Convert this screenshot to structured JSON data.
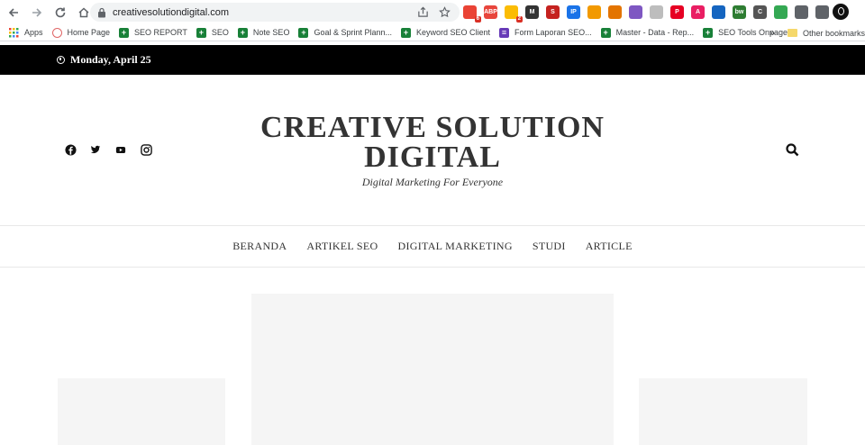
{
  "browser": {
    "url": "creativesolutiondigital.com",
    "extensions": [
      {
        "name": "gmail-extension-icon",
        "color": "#ea4335",
        "badge": "6"
      },
      {
        "name": "adblock-icon",
        "color": "#e8453c",
        "label": "ABP"
      },
      {
        "name": "extension-2-icon",
        "color": "#fbbc04",
        "badge": "2"
      },
      {
        "name": "m-extension-icon",
        "color": "#333333",
        "label": "M"
      },
      {
        "name": "s-extension-icon",
        "color": "#c5221f",
        "label": "S"
      },
      {
        "name": "ip-extension-icon",
        "color": "#1a73e8",
        "label": "IP"
      },
      {
        "name": "sun-extension-icon",
        "color": "#f29900"
      },
      {
        "name": "face-extension-icon",
        "color": "#e37400"
      },
      {
        "name": "color-extension-icon",
        "color": "#7e57c2"
      },
      {
        "name": "moon-extension-icon",
        "color": "#bdbdbd"
      },
      {
        "name": "pinterest-icon",
        "color": "#e60023",
        "label": "P"
      },
      {
        "name": "a-extension-icon",
        "color": "#e91e63",
        "label": "A"
      },
      {
        "name": "person-extension-icon",
        "color": "#1565c0"
      },
      {
        "name": "bw-extension-icon",
        "color": "#2e7d32",
        "label": "bw"
      },
      {
        "name": "c-extension-icon",
        "color": "#555555",
        "label": "C"
      },
      {
        "name": "dots-extension-icon",
        "color": "#34a853"
      },
      {
        "name": "puzzle-icon",
        "color": "#5f6368"
      },
      {
        "name": "sidebar-icon",
        "color": "#5f6368"
      }
    ]
  },
  "bookmarks": {
    "items": [
      {
        "label": "Apps",
        "type": "apps"
      },
      {
        "label": "Home Page",
        "type": "home"
      },
      {
        "label": "SEO REPORT",
        "type": "sheet"
      },
      {
        "label": "SEO",
        "type": "sheet"
      },
      {
        "label": "Note SEO",
        "type": "sheet"
      },
      {
        "label": "Goal & Sprint Plann...",
        "type": "sheet"
      },
      {
        "label": "Keyword SEO Client",
        "type": "sheet"
      },
      {
        "label": "Form Laporan SEO...",
        "type": "form"
      },
      {
        "label": "Master - Data - Rep...",
        "type": "sheet"
      },
      {
        "label": "SEO Tools Onpage...",
        "type": "sheet"
      }
    ],
    "more": "»",
    "other": "Other bookmarks"
  },
  "page": {
    "date": "Monday, April 25",
    "site_title": "CREATIVE SOLUTION DIGITAL",
    "tagline": "Digital Marketing For Everyone",
    "menu": [
      "BERANDA",
      "ARTIKEL SEO",
      "DIGITAL MARKETING",
      "STUDI",
      "ARTICLE"
    ],
    "social": [
      "facebook-icon",
      "twitter-icon",
      "youtube-icon",
      "instagram-icon"
    ]
  }
}
